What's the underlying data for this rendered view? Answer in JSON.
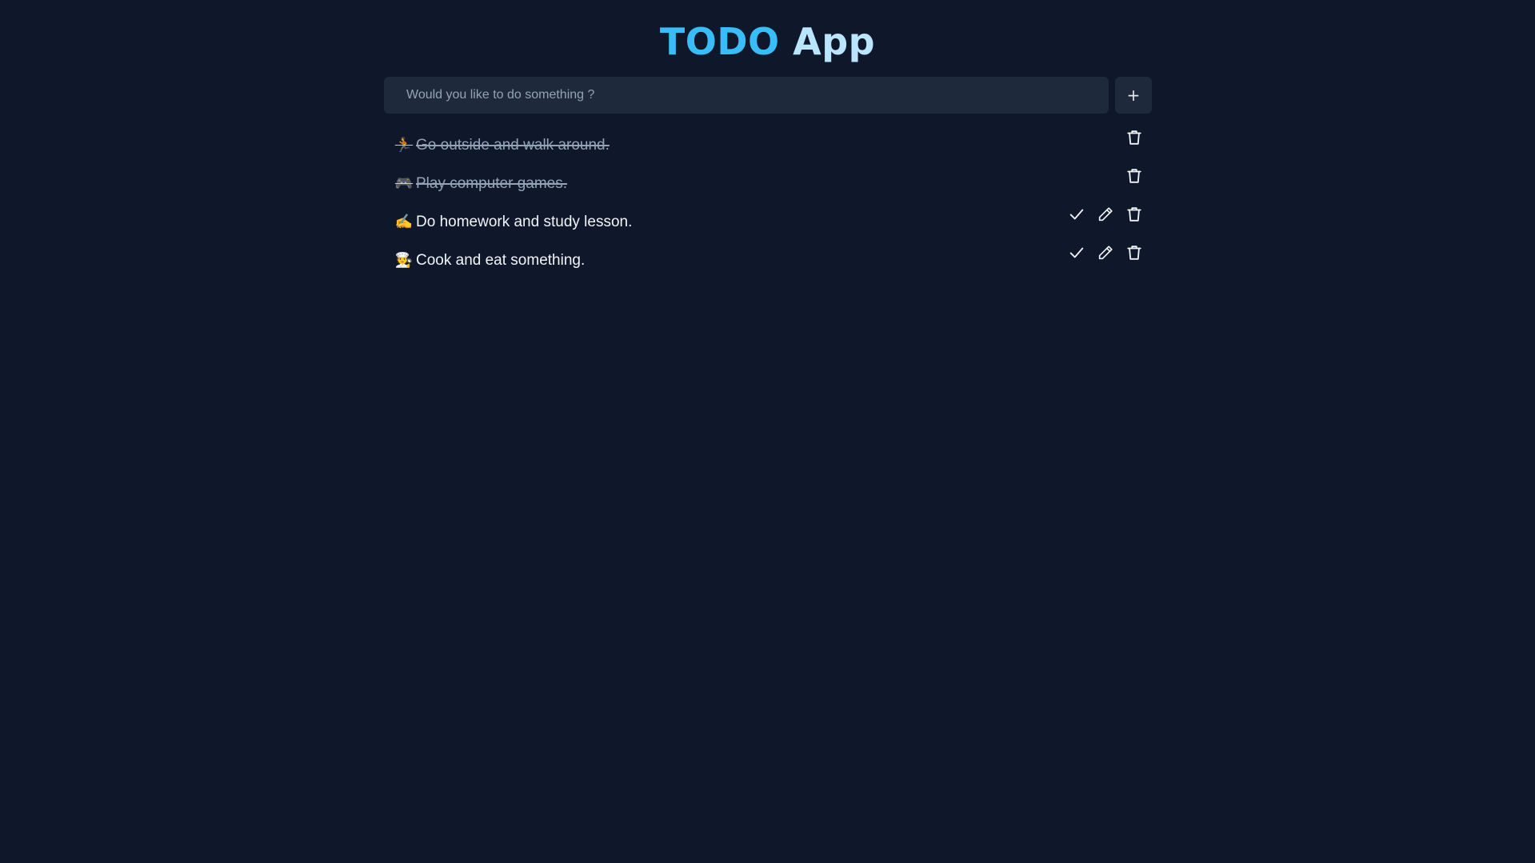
{
  "header": {
    "title_accent": "TODO",
    "title_rest": "App"
  },
  "add_bar": {
    "placeholder": "Would you like to do something ?",
    "value": "",
    "add_label": "+"
  },
  "todos": [
    {
      "emoji": "🏃",
      "text": "Go outside and walk around.",
      "done": true
    },
    {
      "emoji": "🎮",
      "text": "Play computer games.",
      "done": true
    },
    {
      "emoji": "✍️",
      "text": "Do homework and study lesson.",
      "done": false
    },
    {
      "emoji": "🧑‍🍳",
      "text": "Cook and eat something.",
      "done": false
    }
  ],
  "icons": {
    "complete": "check-icon",
    "edit": "pencil-icon",
    "delete": "trash-icon"
  },
  "colors": {
    "background": "#0f172a",
    "surface": "#1e293b",
    "accent": "#38bdf8",
    "accent_light": "#bae6fd",
    "done_text": "#94a3b8"
  }
}
